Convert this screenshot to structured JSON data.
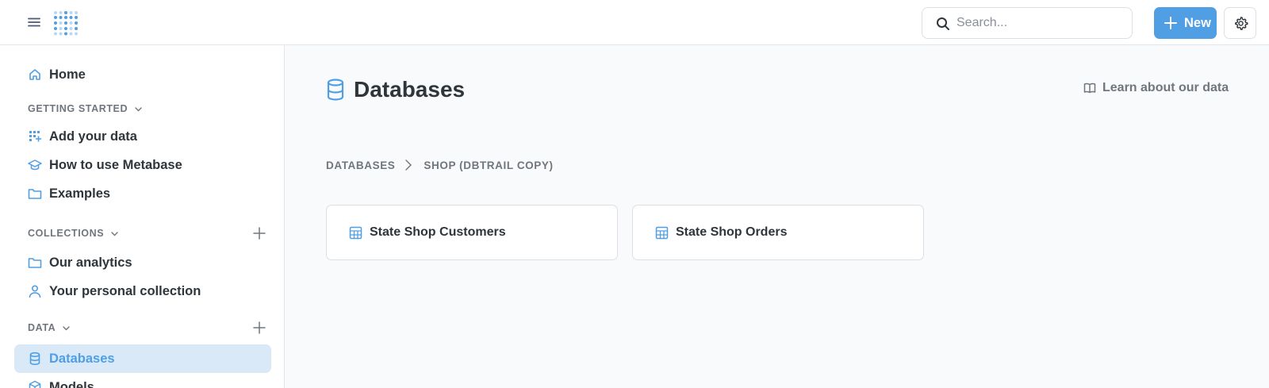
{
  "colors": {
    "brand": "#509ee3",
    "active_bg": "#d9e9f8",
    "text": "#2e353b",
    "muted": "#6f767e"
  },
  "topbar": {
    "search_placeholder": "Search...",
    "new_label": "New"
  },
  "sidebar": {
    "home": "Home",
    "getting_started": {
      "title": "GETTING STARTED",
      "items": [
        "Add your data",
        "How to use Metabase",
        "Examples"
      ]
    },
    "collections": {
      "title": "COLLECTIONS",
      "items": [
        "Our analytics",
        "Your personal collection"
      ]
    },
    "data": {
      "title": "DATA",
      "items": [
        "Databases",
        "Models"
      ]
    }
  },
  "main": {
    "title": "Databases",
    "learn_link": "Learn about our data",
    "breadcrumbs": [
      "DATABASES",
      "SHOP (DBTRAIL COPY)"
    ],
    "tables": [
      "State Shop Customers",
      "State Shop Orders"
    ]
  }
}
